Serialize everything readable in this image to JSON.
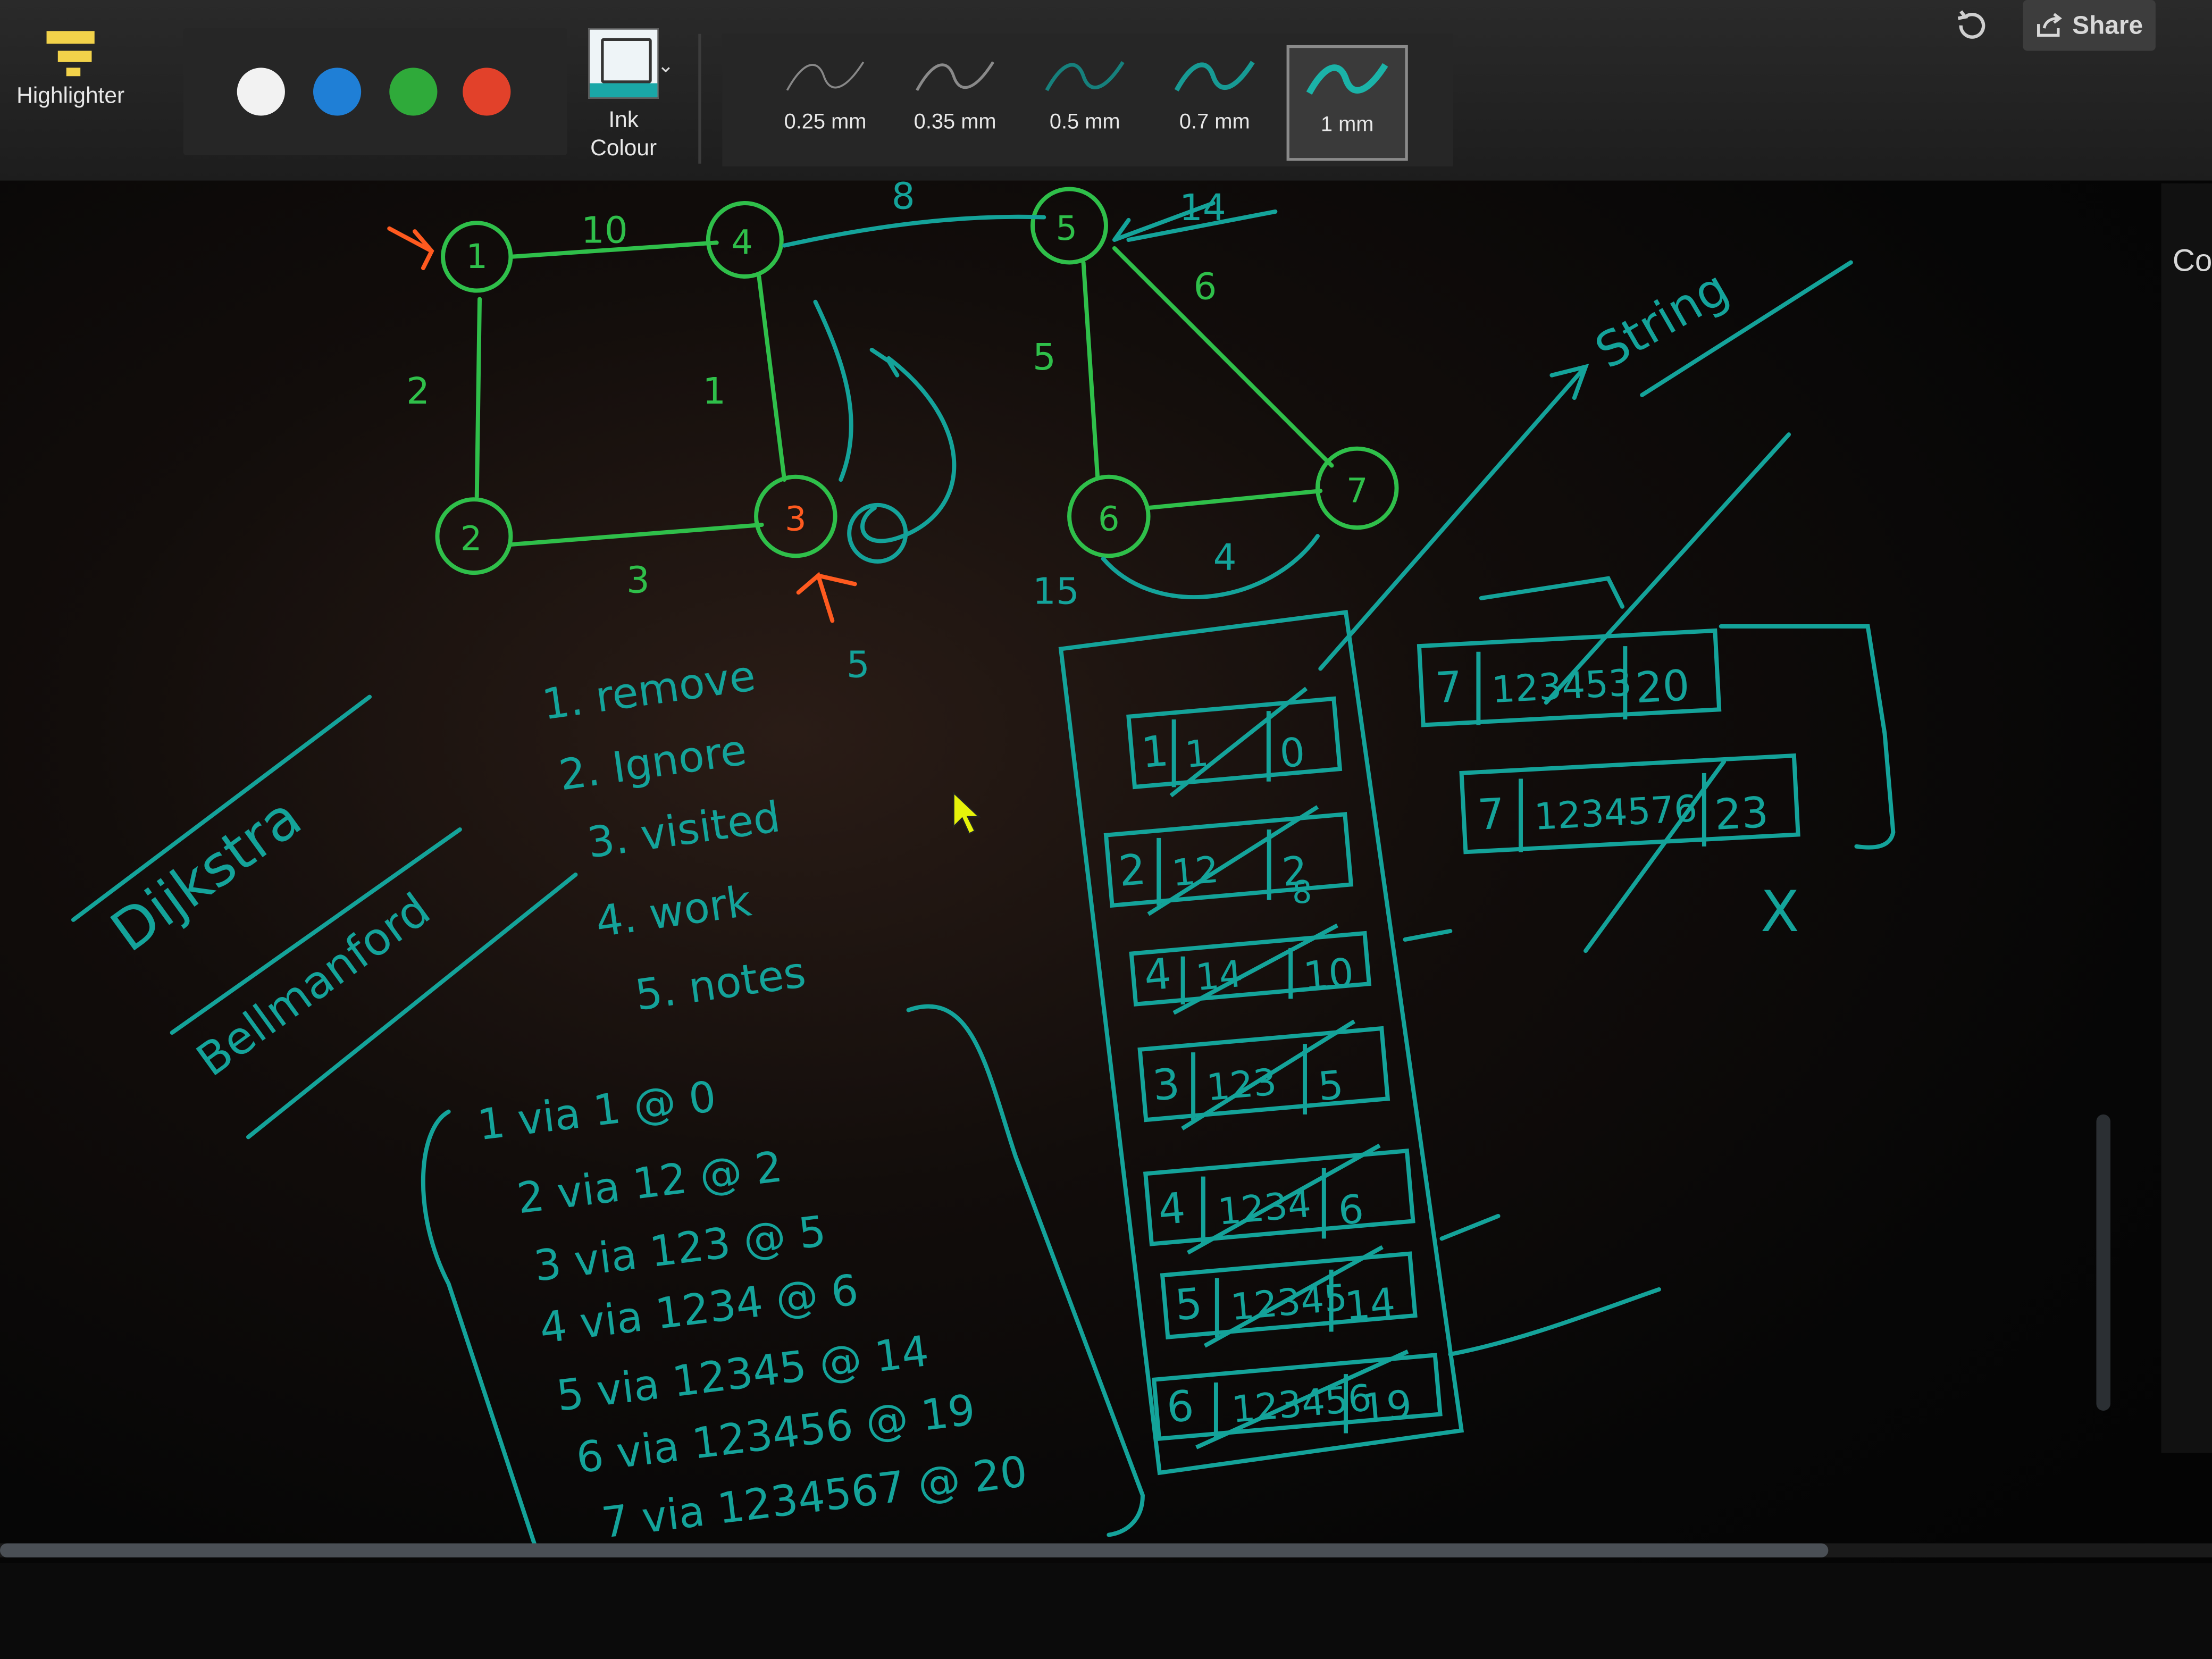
{
  "toolbar": {
    "highlighter_label": "Highlighter",
    "ink_colour_label": "Ink\nColour",
    "colors": [
      "#f2f2f2",
      "#1f7fd6",
      "#2faa3a",
      "#e2412a"
    ],
    "thickness": [
      {
        "label": "0.25 mm",
        "active": false
      },
      {
        "label": "0.35 mm",
        "active": false
      },
      {
        "label": "0.5 mm",
        "active": false
      },
      {
        "label": "0.7 mm",
        "active": false
      },
      {
        "label": "1 mm",
        "active": true
      }
    ],
    "share_label": "Share"
  },
  "side_panel_text": "Co",
  "ink_colors": {
    "green": "#2fbf4a",
    "teal": "#14a39a",
    "orange": "#ff5a1f"
  },
  "graph": {
    "nodes": [
      "1",
      "4",
      "5",
      "2",
      "3",
      "6",
      "7"
    ],
    "edge_weights": [
      "10",
      "2",
      "1",
      "3",
      "8",
      "6",
      "5",
      "4",
      "14",
      "15",
      "5"
    ]
  },
  "headings": [
    "Dijkstra",
    "Bellmanford",
    "String"
  ],
  "rules": [
    "1. remove",
    "2. Ignore",
    "3. visited",
    "4. work",
    "5. notes"
  ],
  "via_list": [
    "1  via  1 @ 0",
    "2  via 12 @ 2",
    "3  via 123 @ 5",
    "4  via 1234 @ 6",
    "5  via 12345 @ 14",
    "6  via 123456 @ 19",
    "7  via 1234567 @ 20"
  ],
  "stack_rows": [
    [
      "1",
      "1",
      "0"
    ],
    [
      "2",
      "12",
      "2"
    ],
    [
      "4",
      "14",
      "10"
    ],
    [
      "3",
      "123",
      "5"
    ],
    [
      "4",
      "1234",
      "6"
    ],
    [
      "5",
      "12345",
      "14"
    ],
    [
      "6",
      "123456",
      "19"
    ]
  ],
  "side_rows": [
    [
      "7",
      "123453",
      "20"
    ],
    [
      "7",
      "1234576",
      "23"
    ]
  ],
  "small_marks": [
    "8",
    "X"
  ]
}
